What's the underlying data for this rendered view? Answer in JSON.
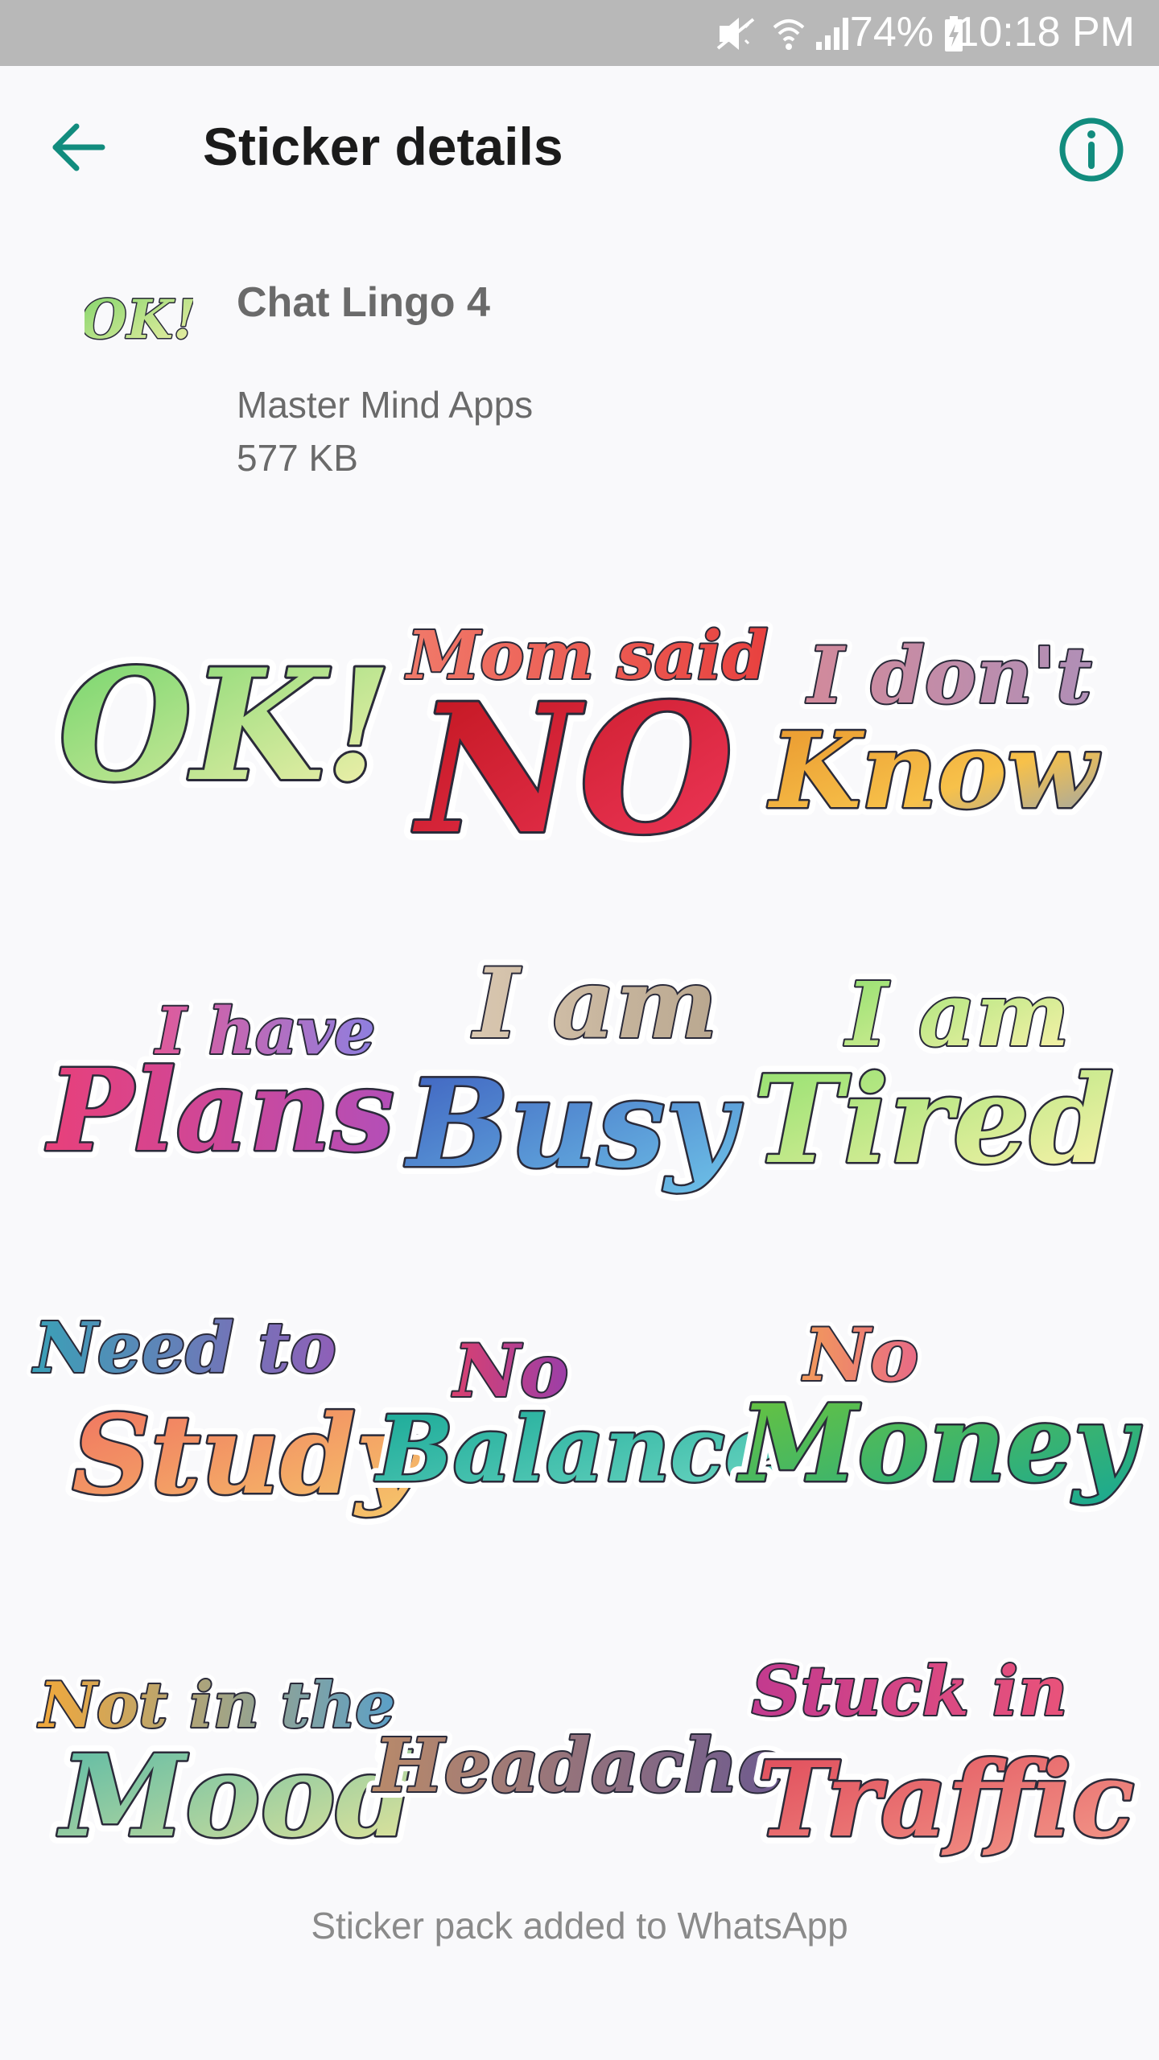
{
  "status_bar": {
    "battery_percent": "74%",
    "time": "10:18 PM",
    "icons": [
      "mute-vibrate-icon",
      "wifi-icon",
      "signal-icon",
      "battery-charging-icon"
    ]
  },
  "toolbar": {
    "title": "Sticker details",
    "back_icon": "arrow-back-icon",
    "info_icon": "info-icon",
    "accent_color": "#128c7e"
  },
  "pack": {
    "tray_icon_text": "OK!",
    "name": "Chat Lingo 4",
    "publisher": "Master Mind Apps",
    "size": "577 KB"
  },
  "stickers": [
    {
      "line1": "OK!",
      "line2": ""
    },
    {
      "line1": "Mom said",
      "line2": "NO"
    },
    {
      "line1": "I don't",
      "line2": "Know"
    },
    {
      "line1": "I have",
      "line2": "Plans"
    },
    {
      "line1": "I am",
      "line2": "Busy"
    },
    {
      "line1": "I am",
      "line2": "Tired"
    },
    {
      "line1": "Need to",
      "line2": "Study"
    },
    {
      "line1": "No",
      "line2": "Balance"
    },
    {
      "line1": "No",
      "line2": "Money"
    },
    {
      "line1": "Not in the",
      "line2": "Mood"
    },
    {
      "line1": "Headache",
      "line2": ""
    },
    {
      "line1": "Stuck in",
      "line2": "Traffic"
    }
  ],
  "footer": {
    "status_text": "Sticker pack added to WhatsApp"
  }
}
